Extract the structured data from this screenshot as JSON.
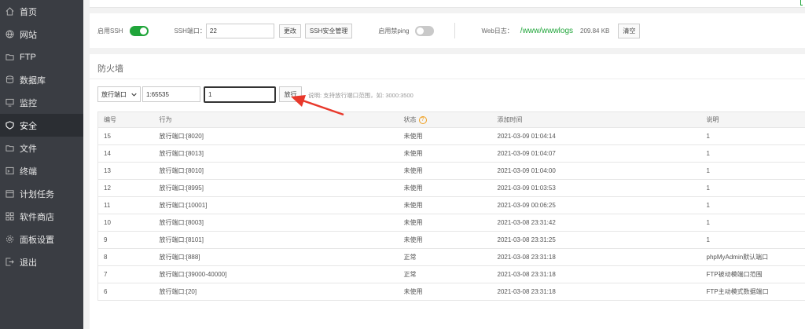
{
  "sidebar": {
    "items": [
      {
        "label": "首页",
        "icon": "home-icon"
      },
      {
        "label": "网站",
        "icon": "globe-icon"
      },
      {
        "label": "FTP",
        "icon": "folder-icon"
      },
      {
        "label": "数据库",
        "icon": "database-icon"
      },
      {
        "label": "监控",
        "icon": "monitor-icon"
      },
      {
        "label": "安全",
        "icon": "shield-icon",
        "active": true
      },
      {
        "label": "文件",
        "icon": "file-folder-icon"
      },
      {
        "label": "终端",
        "icon": "terminal-icon"
      },
      {
        "label": "计划任务",
        "icon": "calendar-icon"
      },
      {
        "label": "软件商店",
        "icon": "grid-icon"
      },
      {
        "label": "面板设置",
        "icon": "gear-icon"
      },
      {
        "label": "退出",
        "icon": "logout-icon"
      }
    ]
  },
  "ssh": {
    "enable_label": "启用SSH",
    "enabled": true,
    "port_label": "SSH端口：",
    "port_value": "22",
    "change_button": "更改",
    "manage_button": "SSH安全管理",
    "ping_label": "启用禁ping",
    "ping_enabled": false,
    "weblog_label": "Web日志：",
    "weblog_path": "/www/wwwlogs",
    "weblog_size": "209.84 KB",
    "clear_button": "清空"
  },
  "firewall": {
    "title": "防火墙",
    "select_value": "放行端口",
    "port_input": "1:65535",
    "remark_input": "1",
    "allow_button": "放行",
    "hint": "说明: 支持放行端口范围，如: 3000:3500",
    "columns": [
      "编号",
      "行为",
      "状态",
      "添加时间",
      "说明"
    ],
    "rows": [
      [
        "15",
        "放行端口:[8020]",
        "未使用",
        "2021-03-09 01:04:14",
        "1"
      ],
      [
        "14",
        "放行端口:[8013]",
        "未使用",
        "2021-03-09 01:04:07",
        "1"
      ],
      [
        "13",
        "放行端口:[8010]",
        "未使用",
        "2021-03-09 01:04:00",
        "1"
      ],
      [
        "12",
        "放行端口:[8995]",
        "未使用",
        "2021-03-09 01:03:53",
        "1"
      ],
      [
        "11",
        "放行端口:[10001]",
        "未使用",
        "2021-03-09 00:06:25",
        "1"
      ],
      [
        "10",
        "放行端口:[8003]",
        "未使用",
        "2021-03-08 23:31:42",
        "1"
      ],
      [
        "9",
        "放行端口:[8101]",
        "未使用",
        "2021-03-08 23:31:25",
        "1"
      ],
      [
        "8",
        "放行端口:[888]",
        "正常",
        "2021-03-08 23:31:18",
        "phpMyAdmin默认端口"
      ],
      [
        "7",
        "放行端口:[39000-40000]",
        "正常",
        "2021-03-08 23:31:18",
        "FTP被动模端口范围"
      ],
      [
        "6",
        "放行端口:[20]",
        "未使用",
        "2021-03-08 23:31:18",
        "FTP主动模式数据端口"
      ]
    ]
  },
  "colors": {
    "sidebar_bg": "#3a3d43",
    "accent_green": "#20a53a",
    "arrow_red": "#e8382b"
  }
}
